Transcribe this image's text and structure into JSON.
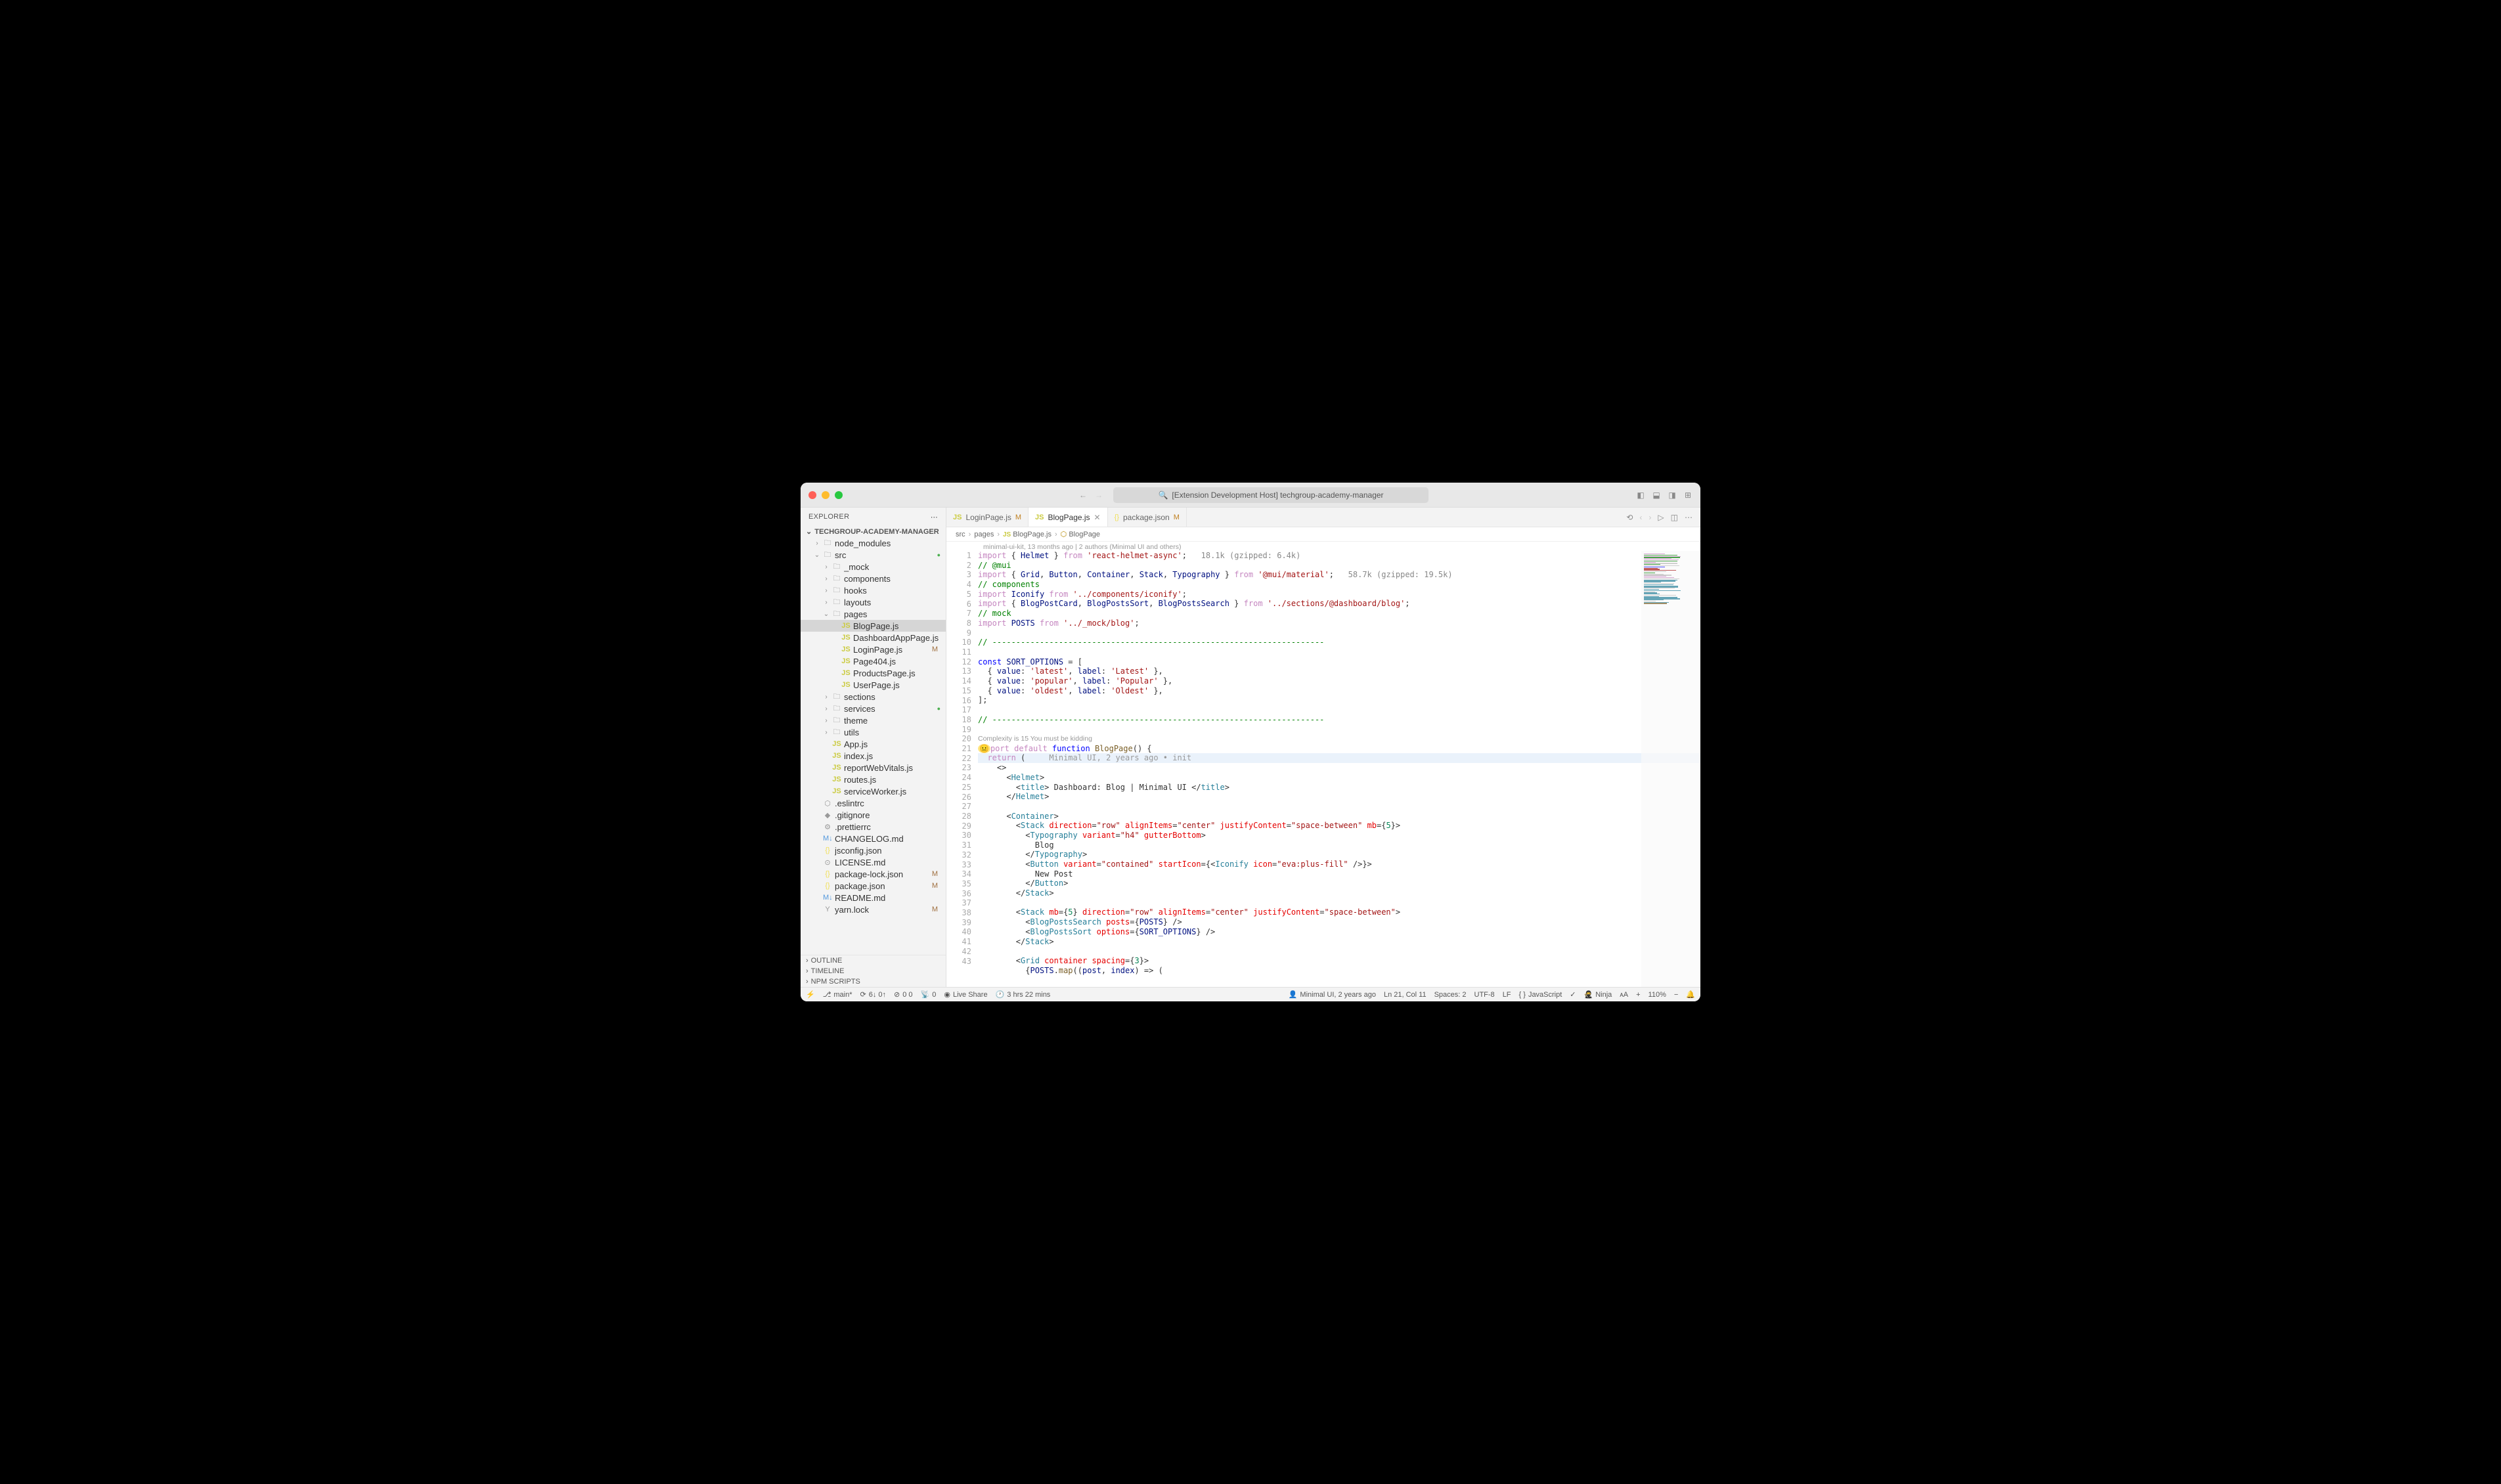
{
  "window": {
    "search_text": "[Extension Development Host] techgroup-academy-manager"
  },
  "sidebar": {
    "title": "EXPLORER",
    "project": "TECHGROUP-ACADEMY-MANAGER",
    "tree": [
      {
        "d": 1,
        "chev": ">",
        "icon": "folder",
        "label": "node_modules",
        "cls": "ic-folder"
      },
      {
        "d": 1,
        "chev": "v",
        "icon": "folder",
        "label": "src",
        "cls": "ic-folder",
        "dot": true
      },
      {
        "d": 2,
        "chev": ">",
        "icon": "folder",
        "label": "_mock",
        "cls": "ic-folder"
      },
      {
        "d": 2,
        "chev": ">",
        "icon": "folder",
        "label": "components",
        "cls": "ic-folder"
      },
      {
        "d": 2,
        "chev": ">",
        "icon": "folder",
        "label": "hooks",
        "cls": "ic-folder"
      },
      {
        "d": 2,
        "chev": ">",
        "icon": "folder",
        "label": "layouts",
        "cls": "ic-folder"
      },
      {
        "d": 2,
        "chev": "v",
        "icon": "folder",
        "label": "pages",
        "cls": "ic-folder"
      },
      {
        "d": 3,
        "icon": "JS",
        "label": "BlogPage.js",
        "cls": "ic-js",
        "active": true
      },
      {
        "d": 3,
        "icon": "JS",
        "label": "DashboardAppPage.js",
        "cls": "ic-js"
      },
      {
        "d": 3,
        "icon": "JS",
        "label": "LoginPage.js",
        "cls": "ic-js",
        "badge": "M"
      },
      {
        "d": 3,
        "icon": "JS",
        "label": "Page404.js",
        "cls": "ic-js"
      },
      {
        "d": 3,
        "icon": "JS",
        "label": "ProductsPage.js",
        "cls": "ic-js"
      },
      {
        "d": 3,
        "icon": "JS",
        "label": "UserPage.js",
        "cls": "ic-js"
      },
      {
        "d": 2,
        "chev": ">",
        "icon": "folder",
        "label": "sections",
        "cls": "ic-folder"
      },
      {
        "d": 2,
        "chev": ">",
        "icon": "folder",
        "label": "services",
        "cls": "ic-folder",
        "dot": true
      },
      {
        "d": 2,
        "chev": ">",
        "icon": "folder",
        "label": "theme",
        "cls": "ic-folder"
      },
      {
        "d": 2,
        "chev": ">",
        "icon": "folder",
        "label": "utils",
        "cls": "ic-folder"
      },
      {
        "d": 2,
        "icon": "JS",
        "label": "App.js",
        "cls": "ic-js"
      },
      {
        "d": 2,
        "icon": "JS",
        "label": "index.js",
        "cls": "ic-js"
      },
      {
        "d": 2,
        "icon": "JS",
        "label": "reportWebVitals.js",
        "cls": "ic-js"
      },
      {
        "d": 2,
        "icon": "JS",
        "label": "routes.js",
        "cls": "ic-js"
      },
      {
        "d": 2,
        "icon": "JS",
        "label": "serviceWorker.js",
        "cls": "ic-js"
      },
      {
        "d": 1,
        "icon": "⬡",
        "label": ".eslintrc",
        "cls": "ic-cfg"
      },
      {
        "d": 1,
        "icon": "◆",
        "label": ".gitignore",
        "cls": "ic-cfg"
      },
      {
        "d": 1,
        "icon": "⚙",
        "label": ".prettierrc",
        "cls": "ic-cfg"
      },
      {
        "d": 1,
        "icon": "M↓",
        "label": "CHANGELOG.md",
        "cls": "ic-md"
      },
      {
        "d": 1,
        "icon": "{}",
        "label": "jsconfig.json",
        "cls": "ic-json"
      },
      {
        "d": 1,
        "icon": "⊙",
        "label": "LICENSE.md",
        "cls": "ic-cfg"
      },
      {
        "d": 1,
        "icon": "{}",
        "label": "package-lock.json",
        "cls": "ic-json",
        "badge": "M"
      },
      {
        "d": 1,
        "icon": "{}",
        "label": "package.json",
        "cls": "ic-json",
        "badge": "M"
      },
      {
        "d": 1,
        "icon": "M↓",
        "label": "README.md",
        "cls": "ic-md"
      },
      {
        "d": 1,
        "icon": "Y",
        "label": "yarn.lock",
        "cls": "ic-cfg",
        "badge": "M"
      }
    ],
    "bottom": [
      "OUTLINE",
      "TIMELINE",
      "NPM SCRIPTS"
    ]
  },
  "tabs": [
    {
      "icon": "JS",
      "label": "LoginPage.js",
      "mod": "M",
      "cls": "ic-js"
    },
    {
      "icon": "JS",
      "label": "BlogPage.js",
      "close": true,
      "cls": "ic-js",
      "active": true
    },
    {
      "icon": "{}",
      "label": "package.json",
      "mod": "M",
      "cls": "ic-json"
    }
  ],
  "breadcrumb": [
    "src",
    "pages",
    "BlogPage.js",
    "BlogPage"
  ],
  "codelens1": "minimal-ui-kit, 13 months ago | 2 authors (Minimal UI and others)",
  "codelens2": "Complexity is 15 You must be kidding",
  "code": [
    {
      "n": 1,
      "h": "<span class='tk-kw'>import</span> { <span class='tk-var'>Helmet</span> } <span class='tk-kw'>from</span> <span class='tk-str'>'react-helmet-async'</span>;   <span class='tk-size'>18.1k (gzipped: 6.4k)</span>"
    },
    {
      "n": 2,
      "h": "<span class='tk-com'>// @mui</span>"
    },
    {
      "n": 3,
      "h": "<span class='tk-kw'>import</span> { <span class='tk-var'>Grid</span>, <span class='tk-var'>Button</span>, <span class='tk-var'>Container</span>, <span class='tk-var'>Stack</span>, <span class='tk-var'>Typography</span> } <span class='tk-kw'>from</span> <span class='tk-str'>'@mui/material'</span>;   <span class='tk-size'>58.7k (gzipped: 19.5k)</span>"
    },
    {
      "n": 4,
      "h": "<span class='tk-com'>// components</span>"
    },
    {
      "n": 5,
      "h": "<span class='tk-kw'>import</span> <span class='tk-var'>Iconify</span> <span class='tk-kw'>from</span> <span class='tk-str'>'../components/iconify'</span>;"
    },
    {
      "n": 6,
      "h": "<span class='tk-kw'>import</span> { <span class='tk-var'>BlogPostCard</span>, <span class='tk-var'>BlogPostsSort</span>, <span class='tk-var'>BlogPostsSearch</span> } <span class='tk-kw'>from</span> <span class='tk-str'>'../sections/@dashboard/blog'</span>;"
    },
    {
      "n": 7,
      "h": "<span class='tk-com'>// mock</span>"
    },
    {
      "n": 8,
      "h": "<span class='tk-kw'>import</span> <span class='tk-var'>POSTS</span> <span class='tk-kw'>from</span> <span class='tk-str'>'../_mock/blog'</span>;"
    },
    {
      "n": 9,
      "h": ""
    },
    {
      "n": 10,
      "h": "<span class='tk-com'>// ----------------------------------------------------------------------</span>"
    },
    {
      "n": 11,
      "h": ""
    },
    {
      "n": 12,
      "h": "<span class='tk-kw2'>const</span> <span class='tk-var'>SORT_OPTIONS</span> = ["
    },
    {
      "n": 13,
      "h": "  { <span class='tk-var'>value</span>: <span class='tk-str'>'latest'</span>, <span class='tk-var'>label</span>: <span class='tk-str'>'Latest'</span> },"
    },
    {
      "n": 14,
      "h": "  { <span class='tk-var'>value</span>: <span class='tk-str'>'popular'</span>, <span class='tk-var'>label</span>: <span class='tk-str'>'Popular'</span> },"
    },
    {
      "n": 15,
      "h": "  { <span class='tk-var'>value</span>: <span class='tk-str'>'oldest'</span>, <span class='tk-var'>label</span>: <span class='tk-str'>'Oldest'</span> },"
    },
    {
      "n": 16,
      "h": "];"
    },
    {
      "n": 17,
      "h": ""
    },
    {
      "n": 18,
      "h": "<span class='tk-com'>// ----------------------------------------------------------------------</span>"
    },
    {
      "n": 19,
      "h": ""
    },
    {
      "n": 20,
      "h": "<span style='background:#ffe680;border-radius:50%;padding:0 2px'>😐</span><span class='tk-kw'>port</span> <span class='tk-kw'>default</span> <span class='tk-kw2'>function</span> <span class='tk-fn'>BlogPage</span>() {",
      "pre": true
    },
    {
      "n": 21,
      "h": "  <span class='tk-kw'>return</span> (     <span class='tk-dim'>Minimal UI, 2 years ago • init</span>",
      "hl": true
    },
    {
      "n": 22,
      "h": "    &lt;&gt;"
    },
    {
      "n": 23,
      "h": "      &lt;<span class='tk-tag'>Helmet</span>&gt;"
    },
    {
      "n": 24,
      "h": "        &lt;<span class='tk-tag'>title</span>&gt; Dashboard: Blog | Minimal UI &lt;/<span class='tk-tag'>title</span>&gt;"
    },
    {
      "n": 25,
      "h": "      &lt;/<span class='tk-tag'>Helmet</span>&gt;"
    },
    {
      "n": 26,
      "h": ""
    },
    {
      "n": 27,
      "h": "      &lt;<span class='tk-tag'>Container</span>&gt;"
    },
    {
      "n": 28,
      "h": "        &lt;<span class='tk-tag'>Stack</span> <span class='tk-attr'>direction</span>=<span class='tk-str'>\"row\"</span> <span class='tk-attr'>alignItems</span>=<span class='tk-str'>\"center\"</span> <span class='tk-attr'>justifyContent</span>=<span class='tk-str'>\"space-between\"</span> <span class='tk-attr'>mb</span>={<span class='tk-num'>5</span>}&gt;"
    },
    {
      "n": 29,
      "h": "          &lt;<span class='tk-tag'>Typography</span> <span class='tk-attr'>variant</span>=<span class='tk-str'>\"h4\"</span> <span class='tk-attr'>gutterBottom</span>&gt;"
    },
    {
      "n": 30,
      "h": "            Blog"
    },
    {
      "n": 31,
      "h": "          &lt;/<span class='tk-tag'>Typography</span>&gt;"
    },
    {
      "n": 32,
      "h": "          &lt;<span class='tk-tag'>Button</span> <span class='tk-attr'>variant</span>=<span class='tk-str'>\"contained\"</span> <span class='tk-attr'>startIcon</span>={&lt;<span class='tk-tag'>Iconify</span> <span class='tk-attr'>icon</span>=<span class='tk-str'>\"eva:plus-fill\"</span> /&gt;}&gt;"
    },
    {
      "n": 33,
      "h": "            New Post"
    },
    {
      "n": 34,
      "h": "          &lt;/<span class='tk-tag'>Button</span>&gt;"
    },
    {
      "n": 35,
      "h": "        &lt;/<span class='tk-tag'>Stack</span>&gt;"
    },
    {
      "n": 36,
      "h": ""
    },
    {
      "n": 37,
      "h": "        &lt;<span class='tk-tag'>Stack</span> <span class='tk-attr'>mb</span>={<span class='tk-num'>5</span>} <span class='tk-attr'>direction</span>=<span class='tk-str'>\"row\"</span> <span class='tk-attr'>alignItems</span>=<span class='tk-str'>\"center\"</span> <span class='tk-attr'>justifyContent</span>=<span class='tk-str'>\"space-between\"</span>&gt;"
    },
    {
      "n": 38,
      "h": "          &lt;<span class='tk-tag'>BlogPostsSearch</span> <span class='tk-attr'>posts</span>={<span class='tk-var'>POSTS</span>} /&gt;"
    },
    {
      "n": 39,
      "h": "          &lt;<span class='tk-tag'>BlogPostsSort</span> <span class='tk-attr'>options</span>={<span class='tk-var'>SORT_OPTIONS</span>} /&gt;"
    },
    {
      "n": 40,
      "h": "        &lt;/<span class='tk-tag'>Stack</span>&gt;"
    },
    {
      "n": 41,
      "h": ""
    },
    {
      "n": 42,
      "h": "        &lt;<span class='tk-tag'>Grid</span> <span class='tk-attr'>container</span> <span class='tk-attr'>spacing</span>={<span class='tk-num'>3</span>}&gt;"
    },
    {
      "n": 43,
      "h": "          {<span class='tk-var'>POSTS</span>.<span class='tk-fn'>map</span>((<span class='tk-var'>post</span>, <span class='tk-var'>index</span>) =&gt; ("
    }
  ],
  "status": {
    "branch": "main*",
    "sync": "6↓ 0↑",
    "problems": "0  0",
    "ports": "0",
    "liveshare": "Live Share",
    "time": "3 hrs 22 mins",
    "blame": "Minimal UI, 2 years ago",
    "pos": "Ln 21, Col 11",
    "spaces": "Spaces: 2",
    "enc": "UTF-8",
    "eol": "LF",
    "lang": "JavaScript",
    "ninja": "Ninja",
    "zoom": "110%"
  }
}
